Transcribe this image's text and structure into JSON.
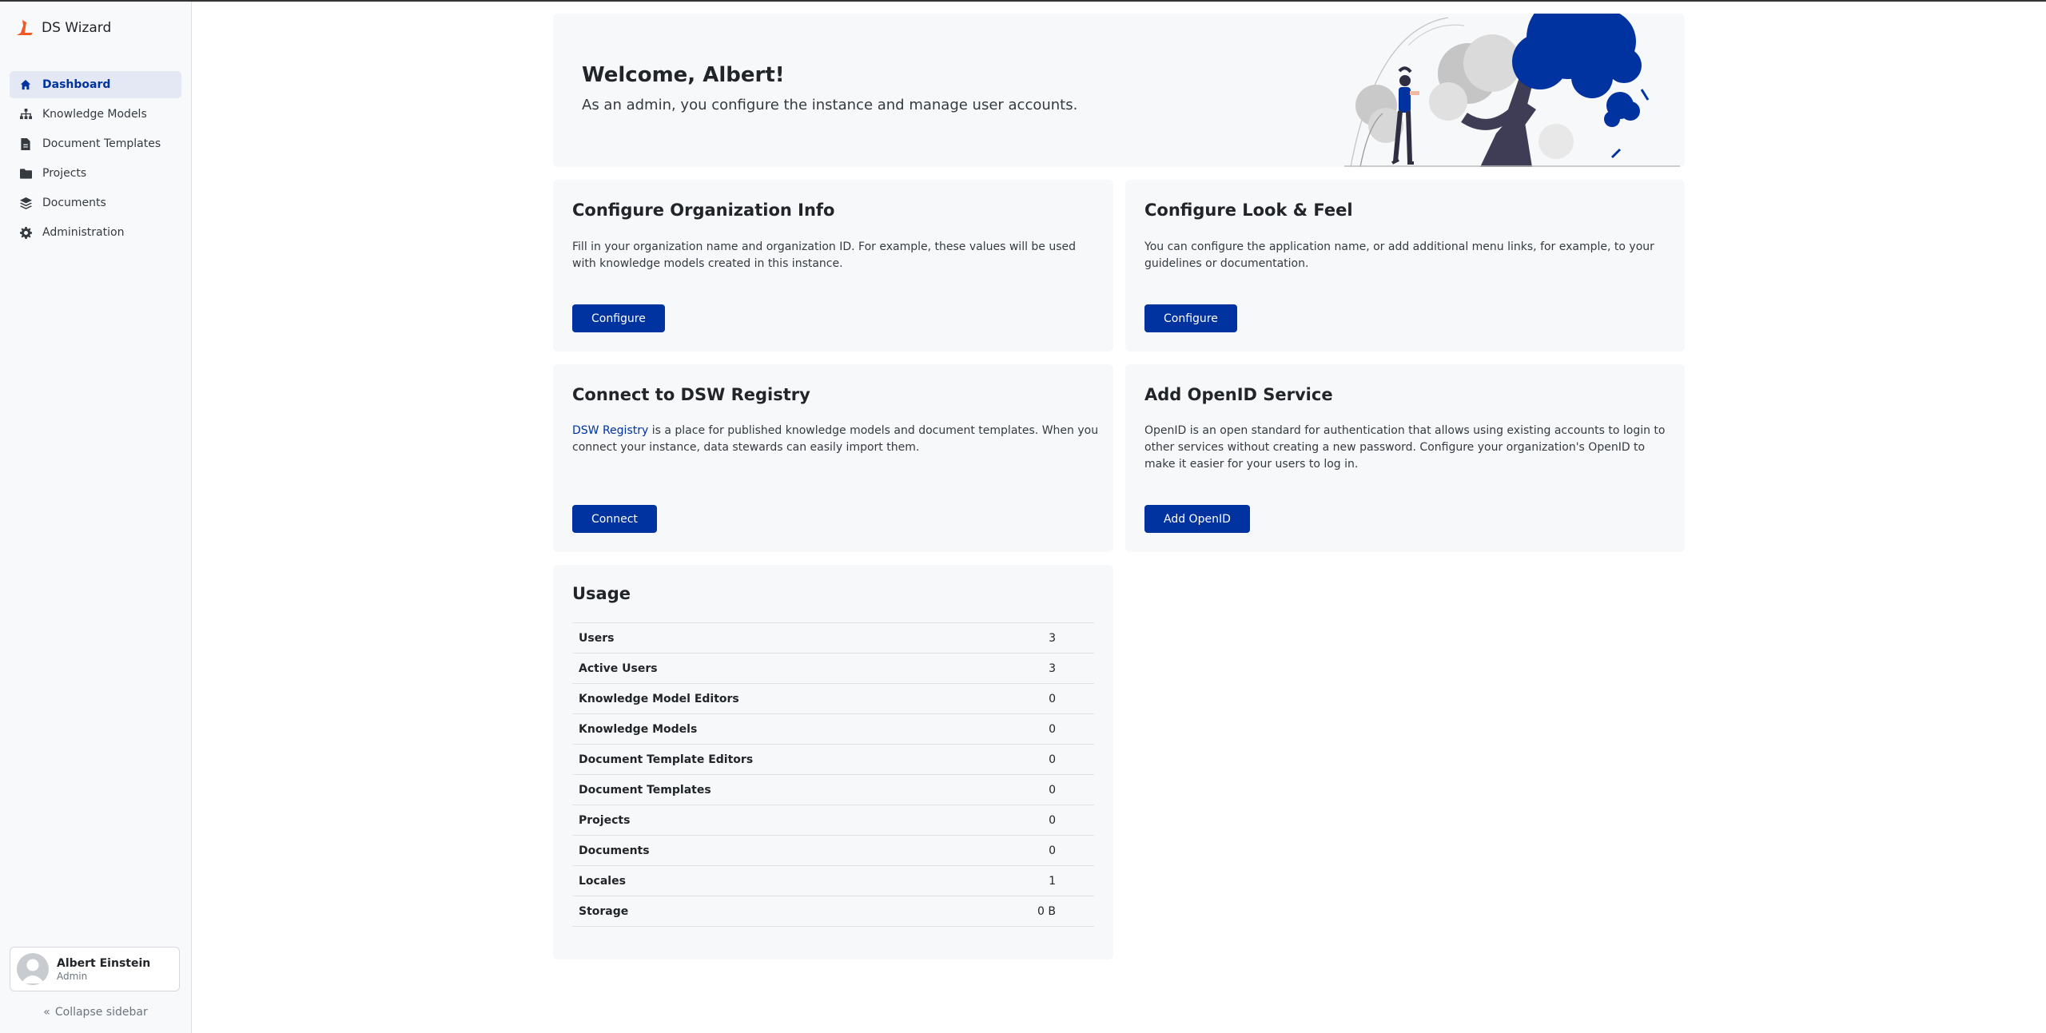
{
  "app": {
    "name": "DS Wizard",
    "accent": "#0033a0",
    "logo_color": "#f05a22"
  },
  "sidebar": {
    "items": [
      {
        "label": "Dashboard",
        "icon": "home-icon",
        "active": true
      },
      {
        "label": "Knowledge Models",
        "icon": "sitemap-icon"
      },
      {
        "label": "Document Templates",
        "icon": "file-icon"
      },
      {
        "label": "Projects",
        "icon": "folder-icon"
      },
      {
        "label": "Documents",
        "icon": "layers-icon"
      },
      {
        "label": "Administration",
        "icon": "gear-icon"
      }
    ],
    "profile": {
      "name": "Albert Einstein",
      "role": "Admin"
    },
    "collapse_label": "Collapse sidebar"
  },
  "welcome": {
    "title": "Welcome, Albert!",
    "subtitle": "As an admin, you configure the instance and manage user accounts."
  },
  "cards": {
    "org": {
      "title": "Configure Organization Info",
      "desc": "Fill in your organization name and organization ID. For example, these values will be used with knowledge models created in this instance.",
      "button": "Configure"
    },
    "look": {
      "title": "Configure Look & Feel",
      "desc": "You can configure the application name, or add additional menu links, for example, to your guidelines or documentation.",
      "button": "Configure"
    },
    "registry": {
      "title": "Connect to DSW Registry",
      "link": "DSW Registry",
      "desc": " is a place for published knowledge models and document templates. When you connect your instance, data stewards can easily import them.",
      "button": "Connect"
    },
    "openid": {
      "title": "Add OpenID Service",
      "desc": "OpenID is an open standard for authentication that allows using existing accounts to login to other services without creating a new password. Configure your organization's OpenID to make it easier for your users to log in.",
      "button": "Add OpenID"
    }
  },
  "usage": {
    "title": "Usage",
    "rows": [
      {
        "label": "Users",
        "value": "3"
      },
      {
        "label": "Active Users",
        "value": "3"
      },
      {
        "label": "Knowledge Model Editors",
        "value": "0"
      },
      {
        "label": "Knowledge Models",
        "value": "0"
      },
      {
        "label": "Document Template Editors",
        "value": "0"
      },
      {
        "label": "Document Templates",
        "value": "0"
      },
      {
        "label": "Projects",
        "value": "0"
      },
      {
        "label": "Documents",
        "value": "0"
      },
      {
        "label": "Locales",
        "value": "1"
      },
      {
        "label": "Storage",
        "value": "0 B"
      }
    ]
  }
}
